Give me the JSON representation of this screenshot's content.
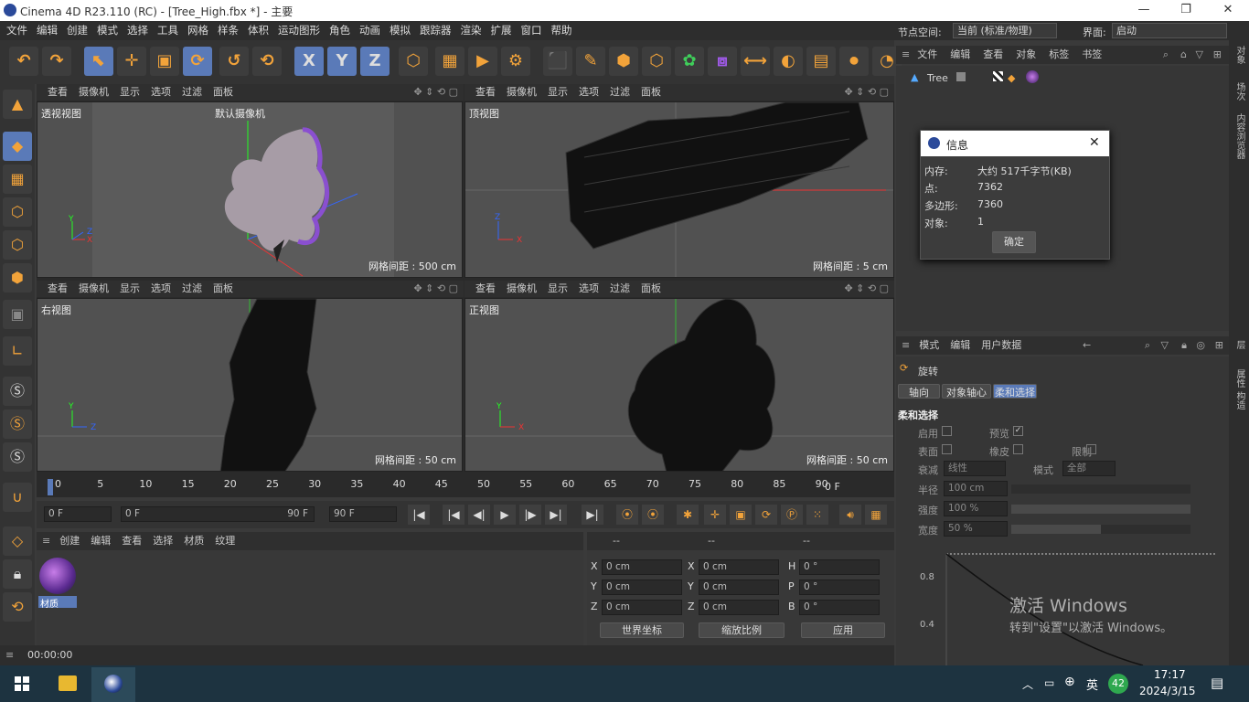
{
  "window": {
    "title": "Cinema 4D R23.110 (RC) - [Tree_High.fbx *] - 主要",
    "min": "—",
    "max": "❐",
    "close": "✕"
  },
  "menu": [
    "文件",
    "编辑",
    "创建",
    "模式",
    "选择",
    "工具",
    "网格",
    "样条",
    "体积",
    "运动图形",
    "角色",
    "动画",
    "模拟",
    "跟踪器",
    "渲染",
    "扩展",
    "窗口",
    "帮助"
  ],
  "node_space_label": "节点空间:",
  "node_space_value": "当前 (标准/物理)",
  "layout_label": "界面:",
  "layout_value": "启动",
  "toolbar_icons": [
    "undo-icon",
    "redo-icon",
    "select-icon",
    "move-icon",
    "scale-icon",
    "rotate-icon",
    "history-icon",
    "recent-icon",
    "x-axis-icon",
    "y-axis-icon",
    "z-axis-icon",
    "coord-icon",
    "render-view-icon",
    "render-icon",
    "render-settings-icon",
    "cube-icon",
    "pen-icon",
    "subdivide-icon",
    "extrude-icon",
    "cloner-icon",
    "array-icon",
    "deformer-icon",
    "field-icon",
    "floor-icon",
    "camera-icon",
    "light-icon"
  ],
  "toolbar_glyphs": [
    "↶",
    "↷",
    "⬉",
    "✛",
    "▣",
    "⟳",
    "↺",
    "⟲",
    "X",
    "Y",
    "Z",
    "⬡",
    "▦",
    "▶",
    "⚙",
    "⬛",
    "✎",
    "⬢",
    "⬡",
    "✿",
    "⧈",
    "⟷",
    "◐",
    "▤",
    "⏺",
    "◔"
  ],
  "viewport_menu": [
    "查看",
    "摄像机",
    "显示",
    "选项",
    "过滤",
    "面板"
  ],
  "viewports": [
    {
      "name": "透视视图",
      "camera": "默认摄像机",
      "grid": "网格间距 : 500 cm"
    },
    {
      "name": "顶视图",
      "grid": "网格间距 : 5 cm"
    },
    {
      "name": "右视图",
      "grid": "网格间距 : 50 cm"
    },
    {
      "name": "正视图",
      "grid": "网格间距 : 50 cm"
    }
  ],
  "objects_menu": [
    "文件",
    "编辑",
    "查看",
    "对象",
    "标签",
    "书签"
  ],
  "object_item": "Tree",
  "info_dialog": {
    "title": "信息",
    "rows": [
      [
        "内存:",
        "大约 517千字节(KB)"
      ],
      [
        "点:",
        "7362"
      ],
      [
        "多边形:",
        "7360"
      ],
      [
        "对象:",
        "1"
      ]
    ],
    "ok": "确定"
  },
  "attr_menu": [
    "模式",
    "编辑",
    "用户数据"
  ],
  "attr_tool": "旋转",
  "attr_tabs": [
    "轴向",
    "对象轴心",
    "柔和选择"
  ],
  "soft_sel": {
    "title": "柔和选择",
    "enable": "启用",
    "preview": "预览",
    "surface": "表面",
    "rubber": "橡皮",
    "limit": "限制",
    "falloff": "衰减",
    "falloff_value": "线性",
    "mode": "模式",
    "mode_value": "全部",
    "radius": "半径",
    "radius_value": "100 cm",
    "strength": "强度",
    "strength_value": "100 %",
    "width": "宽度",
    "width_value": "50 %",
    "curve_labels": [
      "0.8",
      "0.4"
    ]
  },
  "timeline": {
    "ticks": [
      "0",
      "5",
      "10",
      "15",
      "20",
      "25",
      "30",
      "35",
      "40",
      "45",
      "50",
      "55",
      "60",
      "65",
      "70",
      "75",
      "80",
      "85",
      "90"
    ],
    "end": "0 F",
    "start_field": "0 F",
    "range_start": "0 F",
    "range_end": "90 F",
    "end_field": "90 F"
  },
  "material_menu": [
    "创建",
    "编辑",
    "查看",
    "选择",
    "材质",
    "纹理"
  ],
  "material_name": "材质",
  "coords": {
    "head": [
      "--",
      "--",
      "--"
    ],
    "rows": [
      [
        "X",
        "0 cm",
        "X",
        "0 cm",
        "H",
        "0 °"
      ],
      [
        "Y",
        "0 cm",
        "Y",
        "0 cm",
        "P",
        "0 °"
      ],
      [
        "Z",
        "0 cm",
        "Z",
        "0 cm",
        "B",
        "0 °"
      ]
    ],
    "world": "世界坐标",
    "scale": "缩放比例",
    "apply": "应用"
  },
  "status_time": "00:00:00",
  "activate": {
    "l1": "激活 Windows",
    "l2": "转到\"设置\"以激活 Windows。"
  },
  "taskbar": {
    "ime": "英",
    "badge": "42",
    "time": "17:17",
    "date": "2024/3/15"
  },
  "right_tabs": [
    "对象",
    "场次",
    "内容浏览器",
    "层",
    "属性",
    "构造"
  ]
}
